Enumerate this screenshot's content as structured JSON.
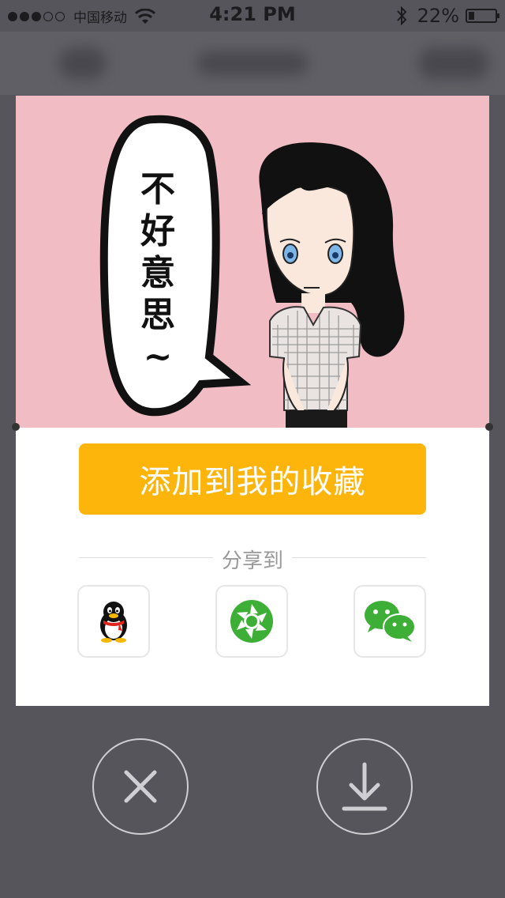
{
  "status_bar": {
    "carrier": "中国移动",
    "time": "4:21 PM",
    "battery": "22%",
    "battery_level": 0.22
  },
  "sticker": {
    "speech_text": "不好意思~",
    "speech_chars": [
      "不",
      "好",
      "意",
      "思",
      "~"
    ]
  },
  "actions": {
    "add_favorite_label": "添加到我的收藏",
    "share_label": "分享到"
  },
  "share_targets": [
    {
      "name": "QQ",
      "icon": "qq-penguin-icon"
    },
    {
      "name": "Moments",
      "icon": "wechat-moments-icon"
    },
    {
      "name": "WeChat",
      "icon": "wechat-icon"
    }
  ],
  "colors": {
    "accent": "#fdb50c",
    "sticker_bg": "#f2bcc4",
    "overlay": "#55555b"
  }
}
